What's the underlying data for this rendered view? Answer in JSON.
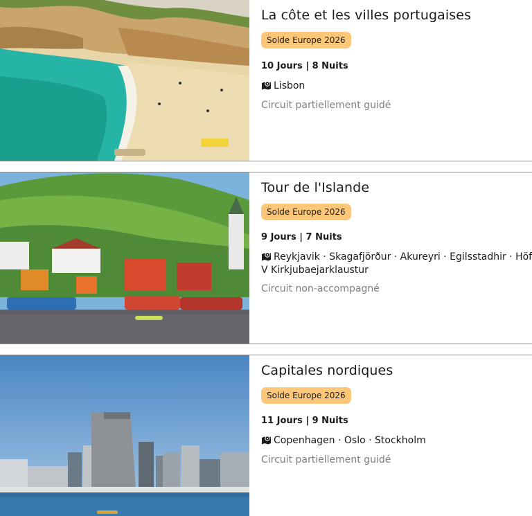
{
  "tours": [
    {
      "title": "La côte et les villes portugaises",
      "badge": "Solde Europe 2026",
      "duration": "10 Jours | 8 Nuits",
      "cities": "Lisbon",
      "guide": "Circuit partiellement guidé",
      "image_alt": "Plage avec falaises et eau turquoise"
    },
    {
      "title": "Tour de l'Islande",
      "badge": "Solde Europe 2026",
      "duration": "9 Jours | 7 Nuits",
      "cities": "Reykjavik · Skagafjörður · Akureyri · Egilsstadhir · Höfn · V Kirkjubaejarklaustur",
      "guide": "Circuit non-accompagné",
      "image_alt": "Port coloré avec colline verte"
    },
    {
      "title": "Capitales nordiques",
      "badge": "Solde Europe 2026",
      "duration": "11 Jours | 9 Nuits",
      "cities": "Copenhagen · Oslo · Stockholm",
      "guide": "Circuit partiellement guidé",
      "image_alt": "Skyline moderne au bord de l'eau"
    }
  ],
  "icons": {
    "location": "map-location-icon"
  },
  "colors": {
    "badge_bg": "#fdc77a",
    "guide_text": "#7e7e7e",
    "divider": "#8c8c8c"
  }
}
